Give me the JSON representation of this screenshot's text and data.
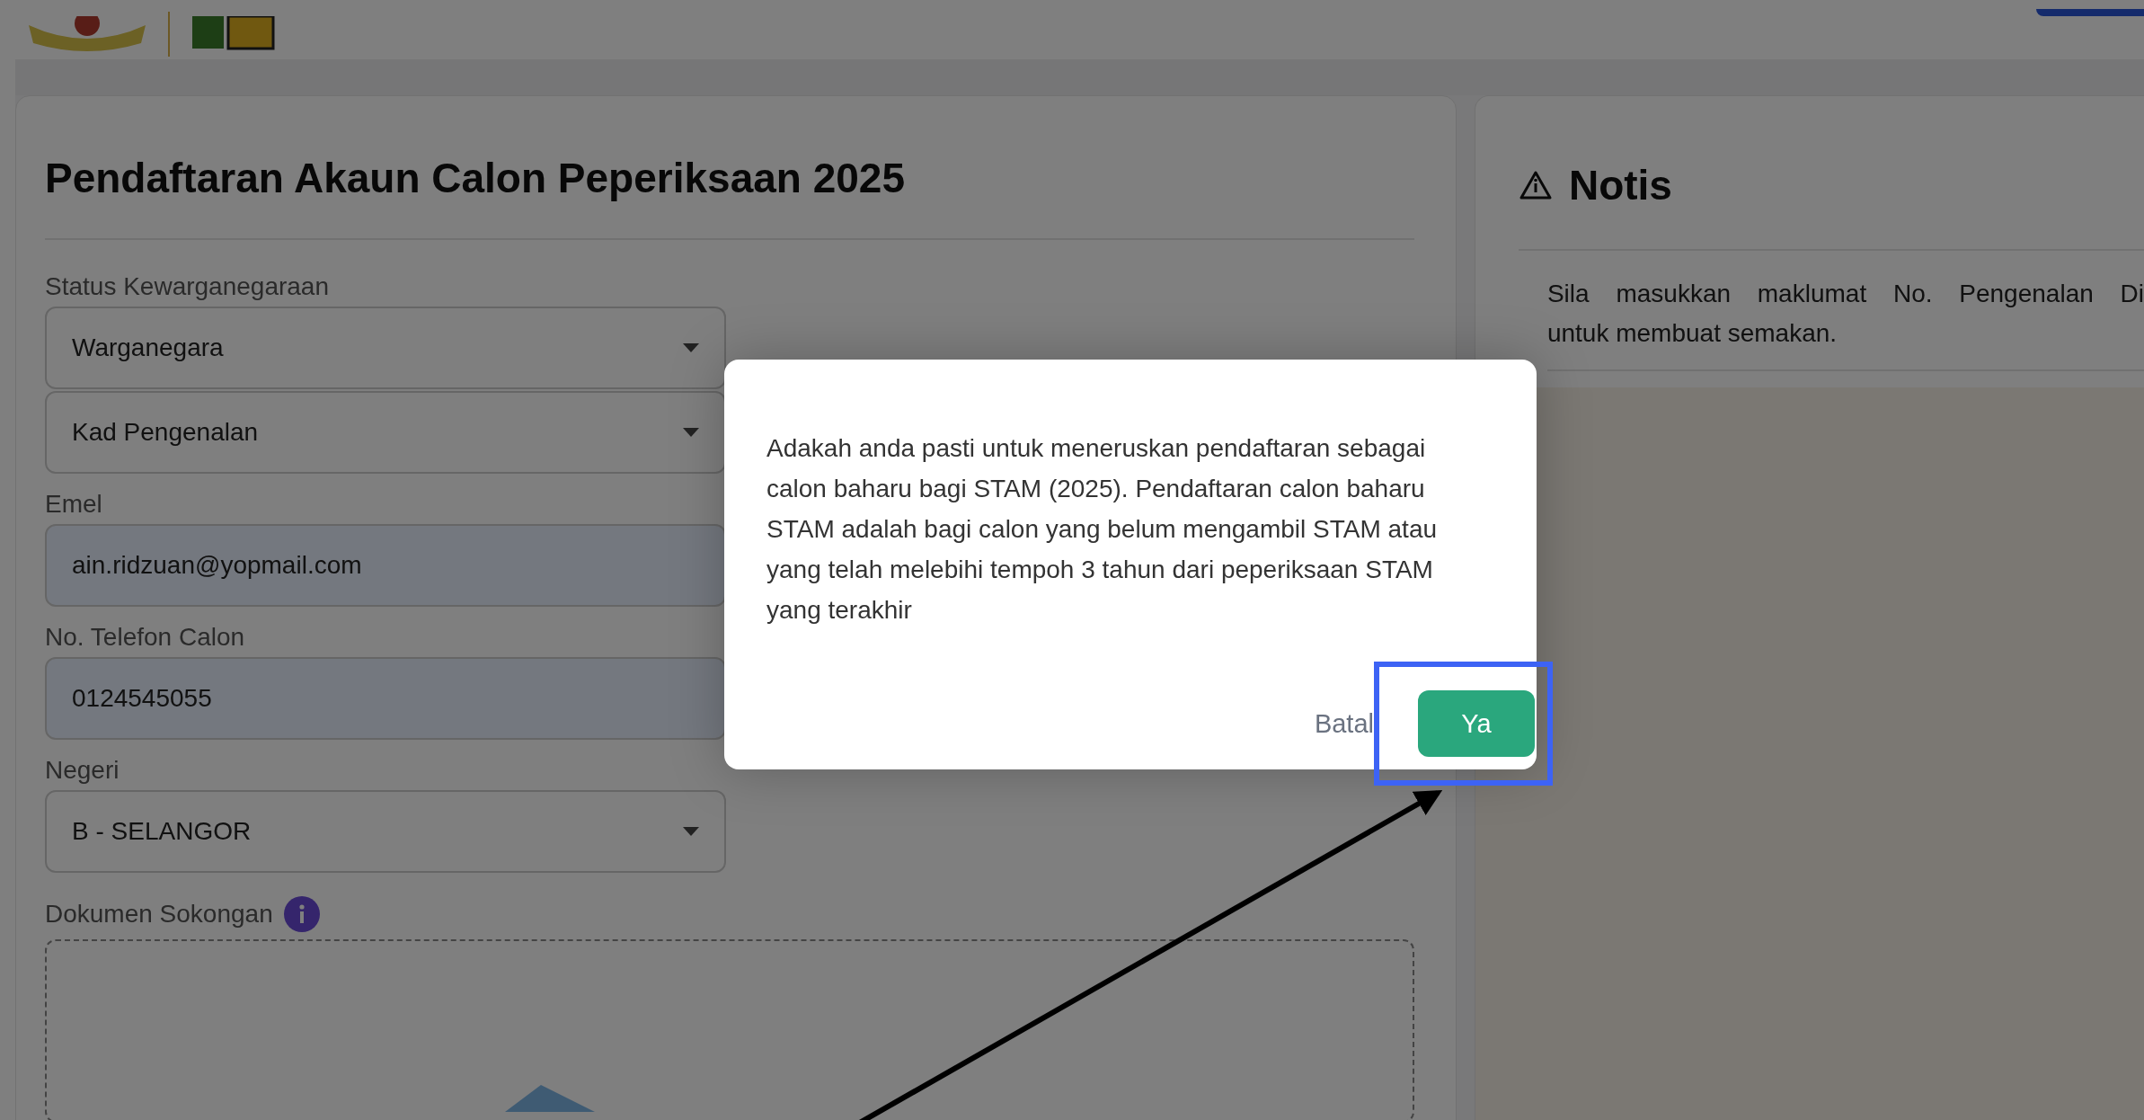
{
  "form": {
    "title": "Pendaftaran Akaun Calon Peperiksaan 2025",
    "fields": [
      {
        "kind": "select",
        "label": "Status Kewarganegaraan",
        "value": "Warganegara"
      },
      {
        "kind": "select",
        "value": "Kad Pengenalan"
      },
      {
        "kind": "input",
        "label": "Emel",
        "value": "ain.ridzuan@yopmail.com"
      },
      {
        "kind": "input",
        "label": "No. Telefon Calon",
        "value": "0124545055"
      },
      {
        "kind": "select",
        "label": "Negeri",
        "value": "B - SELANGOR"
      }
    ],
    "upload": {
      "label": "Dokumen Sokongan"
    }
  },
  "notice": {
    "title": "Notis",
    "lines": [
      "Sila masukkan maklumat No. Pengenalan Di",
      "untuk membuat semakan."
    ]
  },
  "dialog": {
    "message": "Adakah anda pasti untuk meneruskan pendaftaran sebagai calon baharu bagi STAM (2025). Pendaftaran calon baharu STAM adalah bagi calon yang belum mengambil STAM atau yang telah melebihi tempoh 3 tahun dari peperiksaan STAM yang terakhir",
    "buttons": [
      {
        "kind": "text",
        "label": "Batal",
        "highlighted": false
      },
      {
        "kind": "primary",
        "label": "Ya",
        "highlighted": true
      }
    ]
  }
}
